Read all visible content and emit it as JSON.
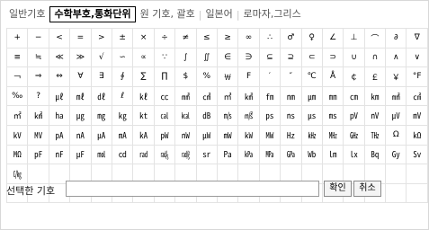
{
  "tabs": [
    {
      "label": "일반기호",
      "active": false
    },
    {
      "label": "수학부호,통화단위",
      "active": true
    },
    {
      "label": "원 기호, 괄호",
      "active": false
    },
    {
      "label": "일본어",
      "active": false
    },
    {
      "label": "로마자,그리스",
      "active": false
    }
  ],
  "symbol_rows": [
    [
      "+",
      "−",
      "<",
      "=",
      ">",
      "±",
      "×",
      "÷",
      "≠",
      "≤",
      "≥",
      "∞",
      "∴",
      "♂",
      "♀",
      "∠",
      "⊥",
      "⌒",
      "∂",
      "∇"
    ],
    [
      "≡",
      "≒",
      "≪",
      "≫",
      "√",
      "∽",
      "∝",
      "∵",
      "∫",
      "∬",
      "∈",
      "∋",
      "⊆",
      "⊇",
      "⊂",
      "⊃",
      "∪",
      "∩",
      "∧",
      "∨"
    ],
    [
      "￢",
      "⇒",
      "⇔",
      "∀",
      "∃",
      "∮",
      "∑",
      "∏",
      "$",
      "%",
      "￦",
      "F",
      "′",
      "″",
      "℃",
      "Å",
      "￠",
      "￡",
      "￥",
      "°F"
    ],
    [
      "‰",
      "?",
      "㎕",
      "㎖",
      "㎗",
      "ℓ",
      "㎘",
      "㏄",
      "㎣",
      "㎤",
      "㎥",
      "㎦",
      "㎙",
      "㎚",
      "㎛",
      "㎜",
      "㎝",
      "㎞",
      "㎟",
      "㎠"
    ],
    [
      "㎡",
      "㎢",
      "㏊",
      "㎍",
      "㎎",
      "㎏",
      "㏏",
      "㎈",
      "㎉",
      "㏈",
      "㎧",
      "㎨",
      "㎰",
      "㎱",
      "㎲",
      "㎳",
      "㎴",
      "㎵",
      "㎶",
      "㎷"
    ],
    [
      "㎸",
      "㎹",
      "㎀",
      "㎁",
      "㎂",
      "㎃",
      "㎄",
      "㎺",
      "㎻",
      "㎼",
      "㎽",
      "㎾",
      "㎿",
      "㎐",
      "㎑",
      "㎒",
      "㎓",
      "㎔",
      "Ω",
      "㏀"
    ],
    [
      "㏁",
      "㎊",
      "㎋",
      "㎌",
      "㏖",
      "㏅",
      "㎭",
      "㎮",
      "㎯",
      "㏛",
      "㎩",
      "㎪",
      "㎫",
      "㎬",
      "㏝",
      "㏐",
      "㏓",
      "㏃",
      "㏉",
      "㏜"
    ],
    [
      "㏆",
      "",
      "",
      " ",
      "",
      "",
      "",
      "",
      "",
      "",
      "",
      "",
      "",
      "",
      "",
      "",
      "",
      "",
      "",
      ""
    ],
    [
      "",
      "",
      "",
      "",
      "",
      "",
      "",
      "",
      "",
      "",
      "",
      "",
      "",
      "",
      "",
      "",
      "",
      "",
      "",
      ""
    ]
  ],
  "bottom": {
    "selected_label": "선택한 기호",
    "selected_value": "",
    "confirm_label": "확인",
    "cancel_label": "취소"
  }
}
